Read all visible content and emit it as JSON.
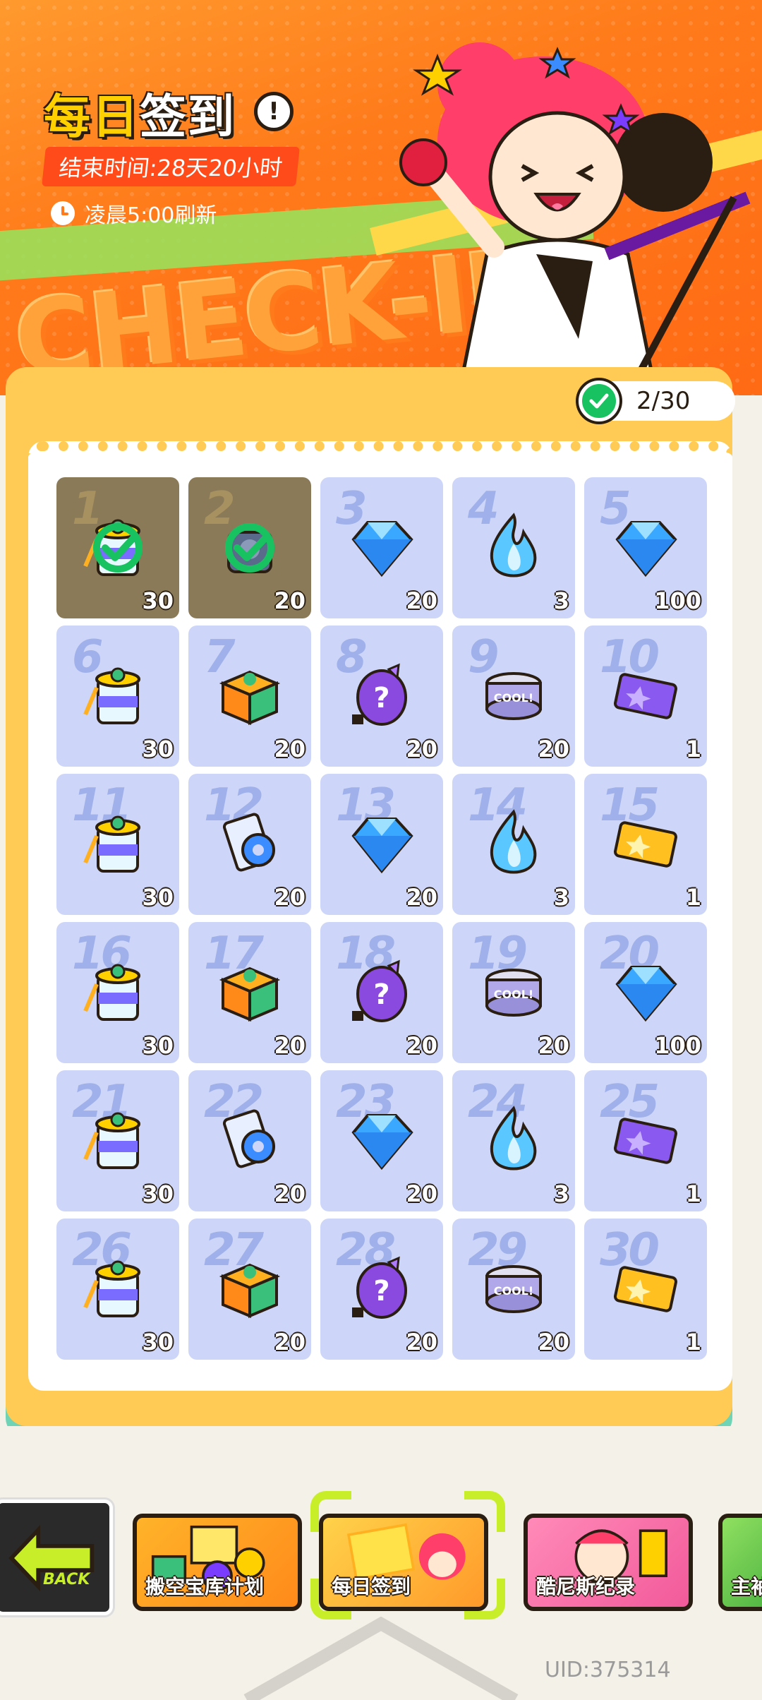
{
  "header": {
    "title_part1": "每日",
    "title_part2": "签到",
    "info_icon": "info-icon",
    "end_time": "结束时间:28天20小时",
    "refresh_text": "凌晨5:00刷新",
    "banner_word": "CHECK-IN"
  },
  "progress": {
    "text": "2/30",
    "checked": 2,
    "total": 30
  },
  "days": [
    {
      "day": "1",
      "item": "bucket",
      "qty": "30",
      "claimed": true
    },
    {
      "day": "2",
      "item": "gear-bag",
      "qty": "20",
      "claimed": true
    },
    {
      "day": "3",
      "item": "diamond",
      "qty": "20",
      "claimed": false
    },
    {
      "day": "4",
      "item": "blue-flame",
      "qty": "3",
      "claimed": false
    },
    {
      "day": "5",
      "item": "diamond",
      "qty": "100",
      "claimed": false
    },
    {
      "day": "6",
      "item": "bucket",
      "qty": "30",
      "claimed": false
    },
    {
      "day": "7",
      "item": "box",
      "qty": "20",
      "claimed": false
    },
    {
      "day": "8",
      "item": "mystery-egg",
      "qty": "20",
      "claimed": false
    },
    {
      "day": "9",
      "item": "can",
      "qty": "20",
      "claimed": false
    },
    {
      "day": "10",
      "item": "purple-ticket",
      "qty": "1",
      "claimed": false
    },
    {
      "day": "11",
      "item": "bucket",
      "qty": "30",
      "claimed": false
    },
    {
      "day": "12",
      "item": "tape",
      "qty": "20",
      "claimed": false
    },
    {
      "day": "13",
      "item": "diamond",
      "qty": "20",
      "claimed": false
    },
    {
      "day": "14",
      "item": "blue-flame",
      "qty": "3",
      "claimed": false
    },
    {
      "day": "15",
      "item": "gold-ticket",
      "qty": "1",
      "claimed": false
    },
    {
      "day": "16",
      "item": "bucket",
      "qty": "30",
      "claimed": false
    },
    {
      "day": "17",
      "item": "box",
      "qty": "20",
      "claimed": false
    },
    {
      "day": "18",
      "item": "mystery-egg",
      "qty": "20",
      "claimed": false
    },
    {
      "day": "19",
      "item": "can",
      "qty": "20",
      "claimed": false
    },
    {
      "day": "20",
      "item": "diamond",
      "qty": "100",
      "claimed": false
    },
    {
      "day": "21",
      "item": "bucket",
      "qty": "30",
      "claimed": false
    },
    {
      "day": "22",
      "item": "tape",
      "qty": "20",
      "claimed": false
    },
    {
      "day": "23",
      "item": "diamond",
      "qty": "20",
      "claimed": false
    },
    {
      "day": "24",
      "item": "blue-flame",
      "qty": "3",
      "claimed": false
    },
    {
      "day": "25",
      "item": "purple-ticket",
      "qty": "1",
      "claimed": false
    },
    {
      "day": "26",
      "item": "bucket",
      "qty": "30",
      "claimed": false
    },
    {
      "day": "27",
      "item": "box",
      "qty": "20",
      "claimed": false
    },
    {
      "day": "28",
      "item": "mystery-egg",
      "qty": "20",
      "claimed": false
    },
    {
      "day": "29",
      "item": "can",
      "qty": "20",
      "claimed": false
    },
    {
      "day": "30",
      "item": "gold-ticket",
      "qty": "1",
      "claimed": false
    }
  ],
  "bottom_nav": {
    "back_label": "BACK",
    "items": [
      {
        "label": "搬空宝库计划",
        "selected": false
      },
      {
        "label": "每日签到",
        "selected": true
      },
      {
        "label": "酷尼斯纪录",
        "selected": false
      },
      {
        "label": "主袖",
        "selected": false
      }
    ]
  },
  "uid": "UID:375314",
  "colors": {
    "banner_orange": "#ff7a1a",
    "panel_yellow": "#ffcb55",
    "cell_blue": "#cdd6f8",
    "claimed_brown": "#8a7a58",
    "check_green": "#18c260",
    "nav_highlight": "#c8ee2a"
  }
}
